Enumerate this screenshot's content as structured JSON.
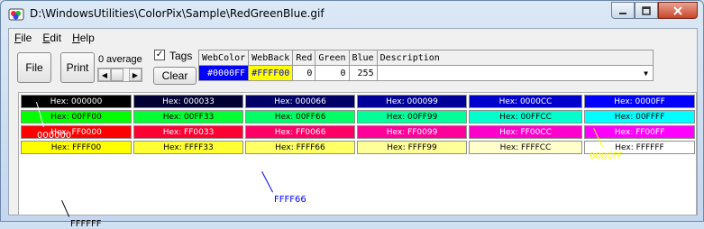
{
  "window": {
    "title": "D:\\WindowsUtilities\\ColorPix\\Sample\\RedGreenBlue.gif",
    "minimize_icon": "minimize-icon",
    "maximize_icon": "maximize-icon",
    "close_icon": "close-icon"
  },
  "menu": [
    {
      "key": "F",
      "rest": "ile"
    },
    {
      "key": "E",
      "rest": "dit"
    },
    {
      "key": "H",
      "rest": "elp"
    }
  ],
  "toolbar": {
    "file_label": "File",
    "print_label": "Print",
    "average_value": "0",
    "average_label": "average",
    "tags_label": "Tags",
    "tags_checked": true,
    "clear_label": "Clear"
  },
  "grid": {
    "headers": [
      "WebColor",
      "WebBack",
      "Red",
      "Green",
      "Blue",
      "Description"
    ],
    "row": {
      "webcolor": "#0000FF",
      "webback": "#FFFF00",
      "red": "0",
      "green": "0",
      "blue": "255",
      "description": ""
    }
  },
  "swatches": [
    [
      {
        "label": "Hex: 000000",
        "bg": "#000000",
        "fg": "#ffffff"
      },
      {
        "label": "Hex: 000033",
        "bg": "#000033",
        "fg": "#ffffff"
      },
      {
        "label": "Hex: 000066",
        "bg": "#000066",
        "fg": "#ffffff"
      },
      {
        "label": "Hex: 000099",
        "bg": "#000099",
        "fg": "#ffffff"
      },
      {
        "label": "Hex: 0000CC",
        "bg": "#0000cc",
        "fg": "#ffffff"
      },
      {
        "label": "Hex: 0000FF",
        "bg": "#0000ff",
        "fg": "#ffffff"
      }
    ],
    [
      {
        "label": "Hex: 00FF00",
        "bg": "#00ff00",
        "fg": "#000000"
      },
      {
        "label": "Hex: 00FF33",
        "bg": "#00ff33",
        "fg": "#000000"
      },
      {
        "label": "Hex: 00FF66",
        "bg": "#00ff66",
        "fg": "#000000"
      },
      {
        "label": "Hex: 00FF99",
        "bg": "#00ff99",
        "fg": "#000000"
      },
      {
        "label": "Hex: 00FFCC",
        "bg": "#00ffcc",
        "fg": "#000000"
      },
      {
        "label": "Hex: 00FFFF",
        "bg": "#00ffff",
        "fg": "#000000"
      }
    ],
    [
      {
        "label": "Hex: FF0000",
        "bg": "#ff0000",
        "fg": "#ffffff"
      },
      {
        "label": "Hex: FF0033",
        "bg": "#ff0033",
        "fg": "#ffffff"
      },
      {
        "label": "Hex: FF0066",
        "bg": "#ff0066",
        "fg": "#ffffff"
      },
      {
        "label": "Hex: FF0099",
        "bg": "#ff0099",
        "fg": "#ffffff"
      },
      {
        "label": "Hex: FF00CC",
        "bg": "#ff00cc",
        "fg": "#ffffff"
      },
      {
        "label": "Hex: FF00FF",
        "bg": "#ff00ff",
        "fg": "#ffffff"
      }
    ],
    [
      {
        "label": "Hex: FFFF00",
        "bg": "#ffff00",
        "fg": "#000000"
      },
      {
        "label": "Hex: FFFF33",
        "bg": "#ffff33",
        "fg": "#000000"
      },
      {
        "label": "Hex: FFFF66",
        "bg": "#ffff66",
        "fg": "#000000"
      },
      {
        "label": "Hex: FFFF99",
        "bg": "#ffff99",
        "fg": "#000000"
      },
      {
        "label": "Hex: FFFFCC",
        "bg": "#ffffcc",
        "fg": "#000000"
      },
      {
        "label": "Hex: FFFFFF",
        "bg": "#ffffff",
        "fg": "#000000"
      }
    ]
  ],
  "tags": [
    {
      "label": "000000",
      "color": "#ffffff"
    },
    {
      "label": "0000FF",
      "color": "#ffff00"
    },
    {
      "label": "FFFF66",
      "color": "#0000ff"
    },
    {
      "label": "FFFFFF",
      "color": "#000000"
    }
  ]
}
